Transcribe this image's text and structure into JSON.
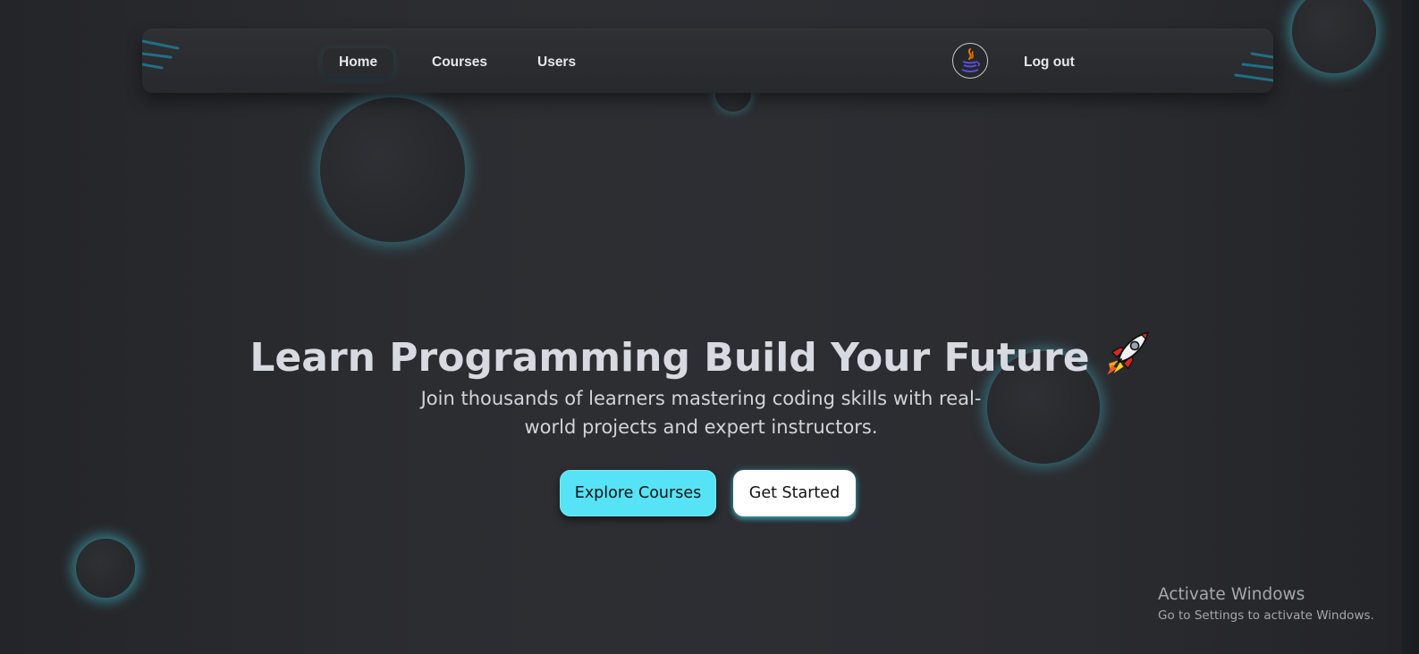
{
  "nav": {
    "home_label": "Home",
    "courses_label": "Courses",
    "users_label": "Users",
    "logout_label": "Log out",
    "avatar_icon": "java-coffee-cup-icon"
  },
  "hero": {
    "title": "Learn Programming Build Your Future",
    "title_icon": "rocket-icon",
    "subtitle": "Join thousands of learners mastering coding skills with real-world projects and expert instructors.",
    "explore_label": "Explore Courses",
    "start_label": "Get Started"
  },
  "watermark": {
    "title": "Activate Windows",
    "subtitle": "Go to Settings to activate Windows."
  },
  "colors": {
    "background": "#2c2d31",
    "navbar": "#2d2e32",
    "accent_cyan": "#56e3f5",
    "glow": "#46c8dc",
    "text": "#d7dae0"
  }
}
